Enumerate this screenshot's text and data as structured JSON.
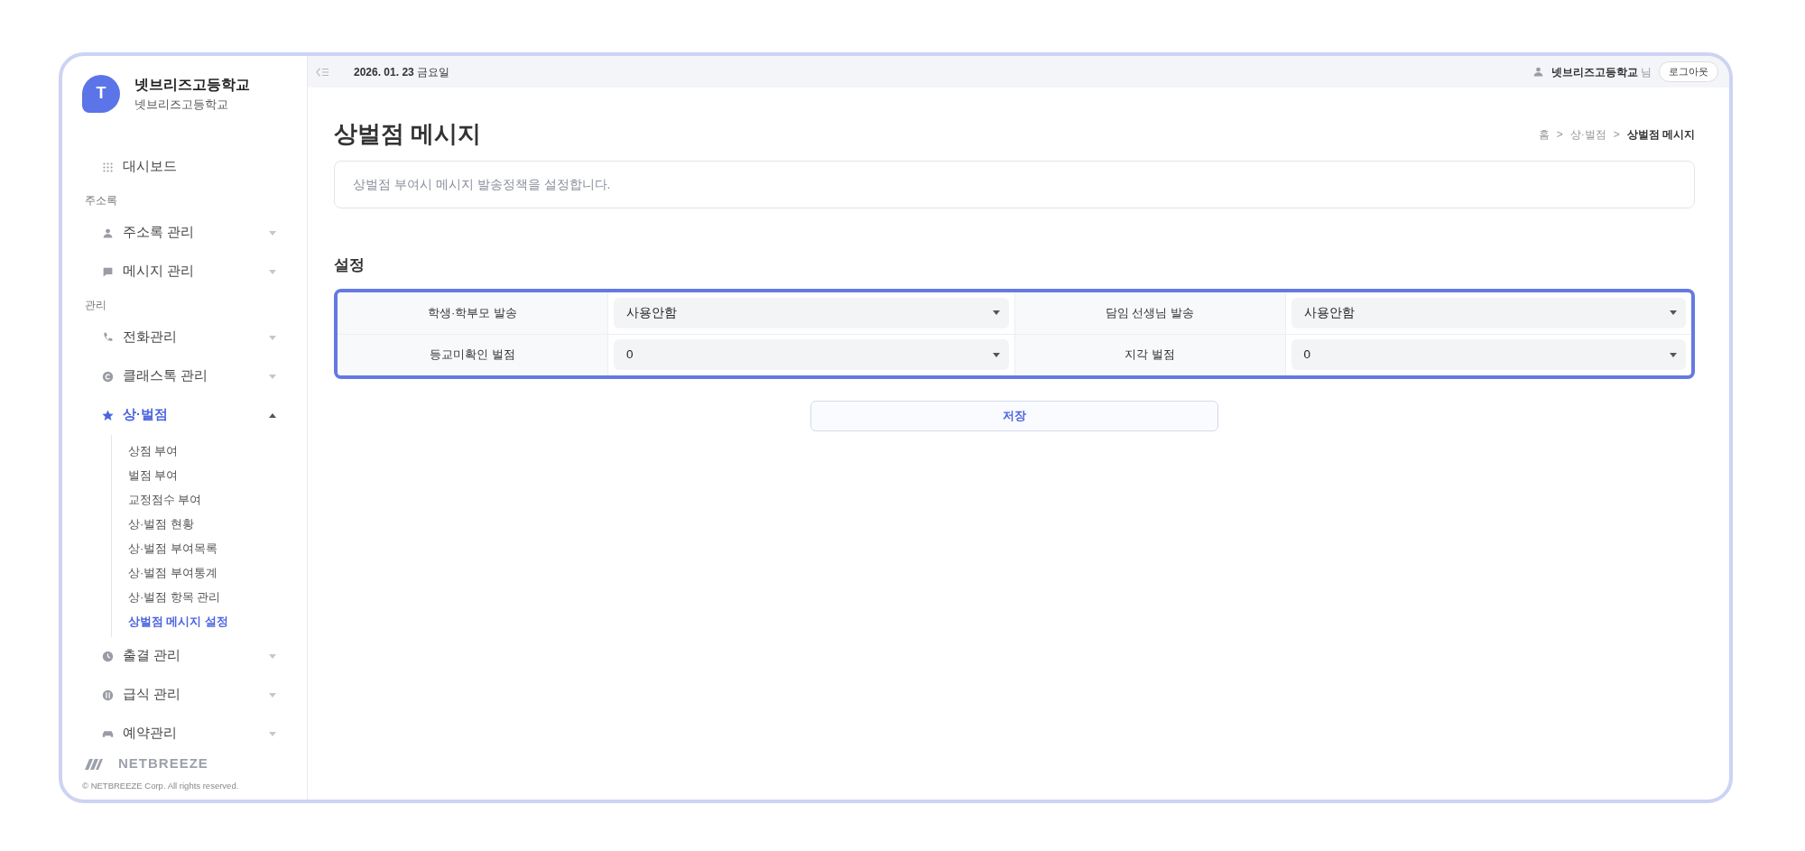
{
  "brand": {
    "avatar": "T",
    "title": "넷브리즈고등학교",
    "subtitle": "넷브리즈고등학교"
  },
  "sidebar": {
    "items": [
      {
        "kind": "link",
        "label": "대시보드",
        "selected": false
      },
      {
        "kind": "section",
        "label": "주소록"
      },
      {
        "kind": "menu",
        "label": "주소록 관리",
        "selected": false,
        "expanded": false
      },
      {
        "kind": "menu",
        "label": "메시지 관리",
        "selected": false,
        "expanded": false
      },
      {
        "kind": "section",
        "label": "관리"
      },
      {
        "kind": "menu",
        "label": "전화관리",
        "selected": false,
        "expanded": false
      },
      {
        "kind": "menu",
        "label": "클래스톡 관리",
        "selected": false,
        "expanded": false
      },
      {
        "kind": "menu",
        "label": "상·벌점",
        "selected": true,
        "expanded": true,
        "children": [
          {
            "label": "상점 부여",
            "selected": false
          },
          {
            "label": "벌점 부여",
            "selected": false
          },
          {
            "label": "교정점수 부여",
            "selected": false
          },
          {
            "label": "상·벌점 현황",
            "selected": false
          },
          {
            "label": "상·벌점 부여목록",
            "selected": false
          },
          {
            "label": "상·벌점 부여통계",
            "selected": false
          },
          {
            "label": "상·벌점 항목 관리",
            "selected": false
          },
          {
            "label": "상벌점 메시지 설정",
            "selected": true
          }
        ]
      },
      {
        "kind": "menu",
        "label": "출결 관리",
        "selected": false,
        "expanded": false
      },
      {
        "kind": "menu",
        "label": "급식 관리",
        "selected": false,
        "expanded": false
      },
      {
        "kind": "menu",
        "label": "예약관리",
        "selected": false,
        "expanded": false
      }
    ]
  },
  "footer": {
    "logo": "NETBREEZE",
    "copyright": "© NETBREEZE Corp. All rights reserved."
  },
  "topbar": {
    "date": "2026. 01. 23",
    "weekday": "금요일",
    "user": "넷브리즈고등학교",
    "honorific": "님",
    "logout": "로그아웃"
  },
  "page": {
    "title": "상벌점 메시지",
    "breadcrumb": [
      "홈",
      "상·벌점",
      "상벌점 메시지"
    ],
    "breadcrumb_separator": ">",
    "description": "상벌점 부여시 메시지 발송정책을 설정합니다."
  },
  "settings": {
    "title": "설정",
    "rows": [
      [
        {
          "label": "학생·학부모 발송",
          "value": "사용안함"
        },
        {
          "label": "담임 선생님 발송",
          "value": "사용안함"
        }
      ],
      [
        {
          "label": "등교미확인 벌점",
          "value": "0"
        },
        {
          "label": "지각 벌점",
          "value": "0"
        }
      ]
    ],
    "save": "저장"
  }
}
